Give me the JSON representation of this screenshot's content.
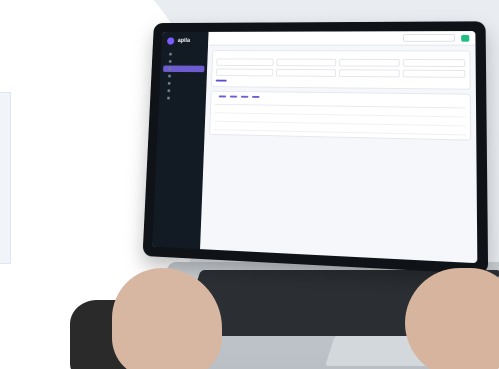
{
  "app": {
    "brand": "apila"
  },
  "colors": {
    "sidebar_bg": "#121a24",
    "accent_purple": "#6d5bd0",
    "accent_green": "#1fbf82",
    "background": "#e9edf1"
  },
  "sidebar": {
    "items": [
      {
        "label": "",
        "icon": "home-icon"
      },
      {
        "label": "",
        "icon": "building-icon"
      },
      {
        "label": "",
        "icon": "folder-icon"
      },
      {
        "label": "",
        "icon": "users-icon"
      },
      {
        "label": "",
        "icon": "document-icon"
      },
      {
        "label": "",
        "icon": "chart-icon"
      },
      {
        "label": "",
        "icon": "settings-icon"
      }
    ]
  },
  "topbar": {
    "crumb": "",
    "search_placeholder": "",
    "primary_button": ""
  },
  "filters": {
    "title": "",
    "button": ""
  },
  "results": {
    "title": "",
    "pills": [
      "",
      "",
      "",
      ""
    ],
    "headers": [
      "",
      "",
      "",
      "",
      "",
      ""
    ],
    "rows": [
      {
        "status": "",
        "type": ""
      },
      {
        "status": "",
        "type": ""
      },
      {
        "status": "",
        "type": ""
      }
    ]
  }
}
